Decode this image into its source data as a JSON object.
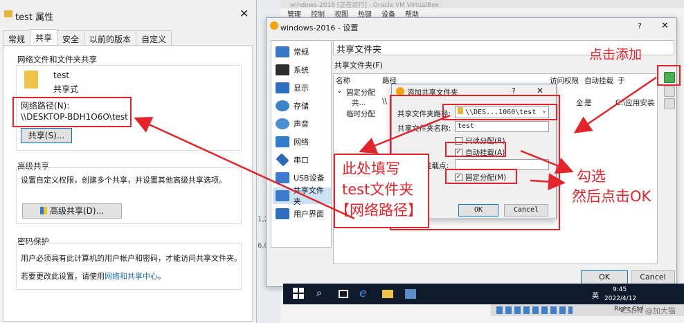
{
  "vbox_bg": {
    "title": "windows-2016 [正在运行] - Oracle VM VirtualBox",
    "menu": [
      "管理",
      "控制",
      "视图",
      "热键",
      "设备",
      "帮助"
    ],
    "frag1": "1,2",
    "frag2": "6,0"
  },
  "props_dialog": {
    "title": "test 属性",
    "close": "✕",
    "tabs": [
      "常规",
      "共享",
      "安全",
      "以前的版本",
      "自定义"
    ],
    "section_share_title": "网络文件和文件夹共享",
    "folder_name": "test",
    "folder_state": "共享式",
    "net_path_label": "网络路径(N):",
    "net_path_value": "\\\\DESKTOP-BDH1O6O\\test",
    "share_button": "共享(S)...",
    "adv_title": "高级共享",
    "adv_desc": "设置自定义权限，创建多个共享，并设置其他高级共享选项。",
    "adv_button": "高级共享(D)...",
    "pwd_title": "密码保护",
    "pwd_desc": "用户必须具有此计算机的用户帐户和密码，才能访问共享文件夹。",
    "pwd_change_prefix": "若要更改此设置，请使用",
    "pwd_link": "网络和共享中心",
    "pwd_suffix": "。"
  },
  "settings_dialog": {
    "title": "windows-2016 - 设置",
    "help": "?",
    "close": "✕",
    "sidebar": [
      {
        "label": "常规",
        "icon": "general-icon",
        "color": "#3a74c4"
      },
      {
        "label": "系统",
        "icon": "system-icon",
        "color": "#2d2d2d"
      },
      {
        "label": "显示",
        "icon": "display-icon",
        "color": "#2f6fc0"
      },
      {
        "label": "存储",
        "icon": "storage-icon",
        "color": "#3b86c9"
      },
      {
        "label": "声音",
        "icon": "audio-icon",
        "color": "#4a8fd1"
      },
      {
        "label": "网络",
        "icon": "network-icon",
        "color": "#2f7fce"
      },
      {
        "label": "串口",
        "icon": "serial-icon",
        "color": "#2b6ab7"
      },
      {
        "label": "USB设备",
        "icon": "usb-icon",
        "color": "#3a7bd0"
      },
      {
        "label": "共享文件夹",
        "icon": "shared-folder-icon",
        "color": "#3a7bd0"
      },
      {
        "label": "用户界面",
        "icon": "ui-icon",
        "color": "#2f6fc0"
      }
    ],
    "section_title": "共享文件夹",
    "list_label": "共享文件夹(F)",
    "columns": {
      "name": "名称",
      "path": "路径",
      "access": "访问权限",
      "automount": "自动挂载",
      "at": "于"
    },
    "group_fixed": "固定分配",
    "row_name": "共...",
    "row_path": "\\\\",
    "row_access": "全",
    "row_automount": "是",
    "row_at": "C:\\应用安装",
    "group_temp": "临时分配",
    "ok": "OK",
    "cancel": "Cancel"
  },
  "add_dialog": {
    "title": "添加共享文件夹",
    "help": "?",
    "close": "✕",
    "path_label": "共享文件夹路径:",
    "path_value": "\\\\DES...1060\\test",
    "name_label": "共享文件夹名称:",
    "name_value": "test",
    "readonly_label": "只读分配(R)",
    "readonly_checked": false,
    "automount_label": "自动挂载(A)",
    "automount_checked": true,
    "mountpoint_label": "挂载点:",
    "mountpoint_value": "",
    "permanent_label": "固定分配(M)",
    "permanent_checked": true,
    "ok": "OK",
    "cancel": "Cancel"
  },
  "taskbar": {
    "time": "9:45",
    "date": "2022/4/12",
    "lang": "英",
    "hostkey": "Right Ctrl",
    "watermark": "CSDN @加大猫"
  },
  "annotations": {
    "click_add": "点击添加",
    "fill_here_1": "此处填写",
    "fill_here_2": "test文件夹",
    "fill_here_3": "【网络路径】",
    "check_1": "勾选",
    "check_2": "然后点击OK"
  },
  "colors": {
    "annotation": "#e3242b",
    "link": "#1565c0",
    "selection": "#cce3f7"
  }
}
